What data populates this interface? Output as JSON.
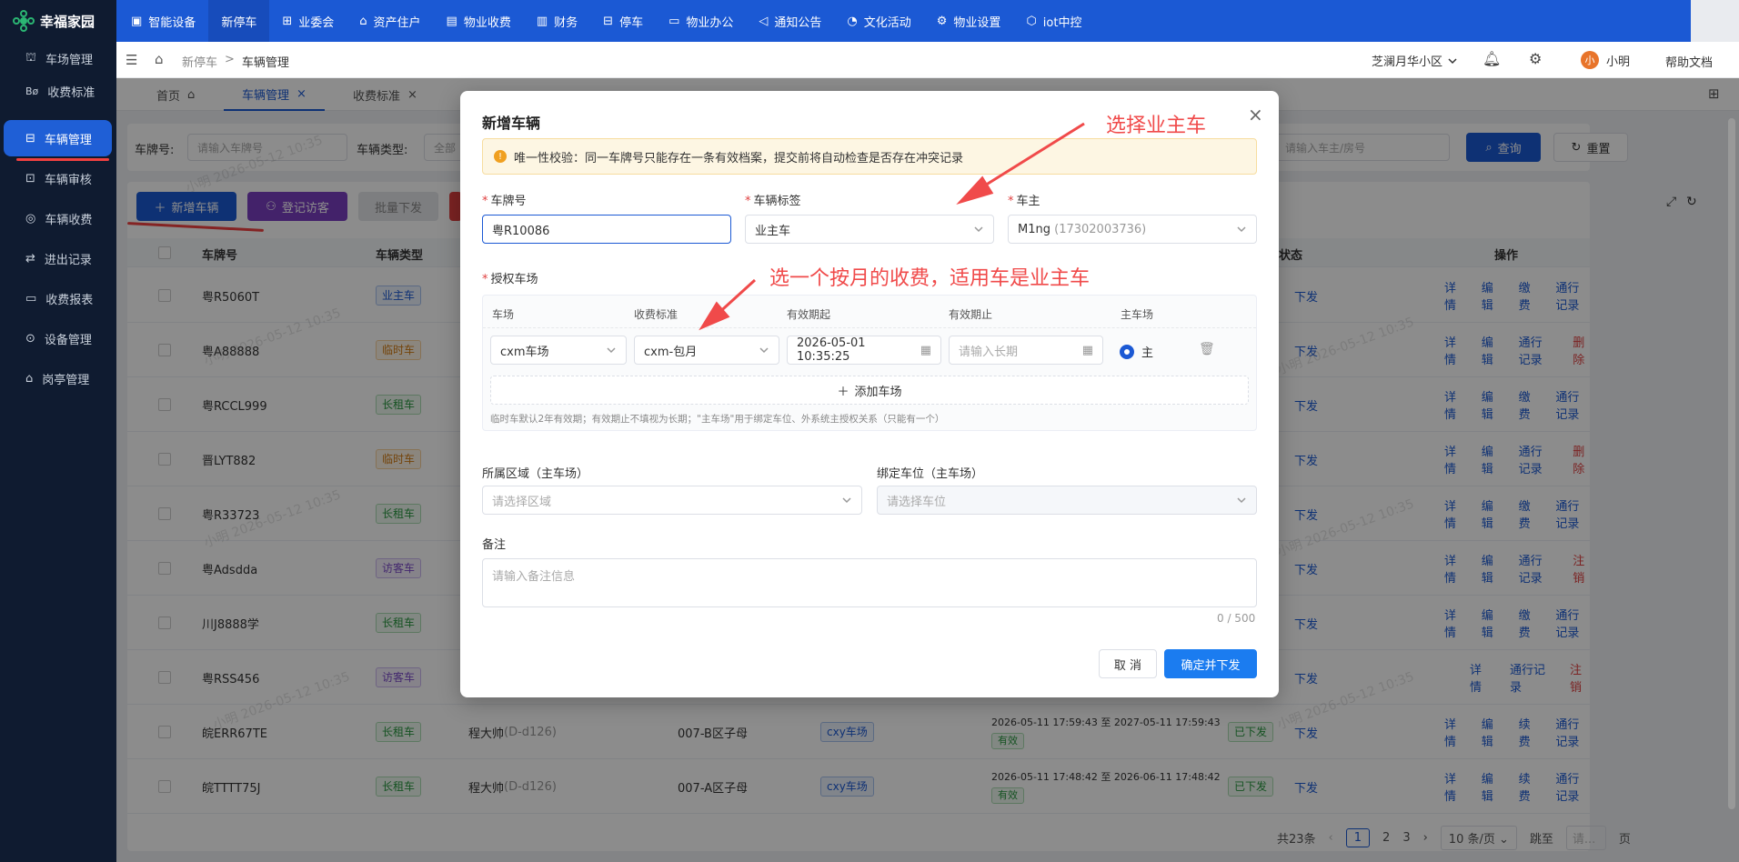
{
  "app": {
    "name": "幸福家园"
  },
  "sidebar": {
    "items": [
      {
        "label": "车场管理"
      },
      {
        "label": "收费标准"
      },
      {
        "label": "车辆管理"
      },
      {
        "label": "车辆审核"
      },
      {
        "label": "车辆收费"
      },
      {
        "label": "进出记录"
      },
      {
        "label": "收费报表"
      },
      {
        "label": "设备管理"
      },
      {
        "label": "岗亭管理"
      }
    ]
  },
  "topnav": {
    "items": [
      {
        "label": "智能设备"
      },
      {
        "label": "新停车"
      },
      {
        "label": "业委会"
      },
      {
        "label": "资产住户"
      },
      {
        "label": "物业收费"
      },
      {
        "label": "财务"
      },
      {
        "label": "停车"
      },
      {
        "label": "物业办公"
      },
      {
        "label": "通知公告"
      },
      {
        "label": "文化活动"
      },
      {
        "label": "物业设置"
      },
      {
        "label": "iot中控"
      }
    ]
  },
  "header": {
    "breadcrumb": [
      "新停车",
      "车辆管理"
    ],
    "separator": ">",
    "community": "芝澜月华小区",
    "avatar_char": "小",
    "user": "小明",
    "help": "帮助文档"
  },
  "tabs": [
    {
      "label": "首页"
    },
    {
      "label": "车辆管理"
    },
    {
      "label": "收费标准"
    }
  ],
  "filters": {
    "plate_label": "车牌号:",
    "plate_placeholder": "请输入车牌号",
    "type_label": "车辆类型:",
    "type_value": "全部",
    "owner_placeholder": "请输入车主/房号",
    "search_btn": "查询",
    "reset_btn": "重置"
  },
  "actions": {
    "add": "新增车辆",
    "visitor": "登记访客",
    "batch": "批量下发"
  },
  "table": {
    "headers": {
      "plate": "车牌号",
      "type": "车辆类型",
      "sync": "同步状态",
      "ops": "操作"
    },
    "rows": [
      {
        "plate": "粤R5060T",
        "type": "业主车",
        "color": "blue",
        "sync": "下发",
        "ops": [
          "详情",
          "编辑",
          "缴费",
          "通行记录"
        ]
      },
      {
        "plate": "粤A88888",
        "type": "临时车",
        "color": "orange",
        "sync": "下发",
        "ops": [
          "详情",
          "编辑",
          "通行记录",
          "删除"
        ]
      },
      {
        "plate": "粤RCCL999",
        "type": "长租车",
        "color": "green",
        "sync": "下发",
        "ops": [
          "详情",
          "编辑",
          "缴费",
          "通行记录"
        ]
      },
      {
        "plate": "晋LYT882",
        "type": "临时车",
        "color": "orange",
        "sync": "下发",
        "ops": [
          "详情",
          "编辑",
          "通行记录",
          "删除"
        ]
      },
      {
        "plate": "粤R33723",
        "type": "长租车",
        "color": "green",
        "sync": "下发",
        "ops": [
          "详情",
          "编辑",
          "缴费",
          "通行记录"
        ]
      },
      {
        "plate": "粤Adsdda",
        "type": "访客车",
        "color": "purple",
        "sync": "下发",
        "ops": [
          "详情",
          "编辑",
          "通行记录",
          "注销"
        ]
      },
      {
        "plate": "川J8888学",
        "type": "长租车",
        "color": "green",
        "sync": "下发",
        "ops": [
          "详情",
          "编辑",
          "缴费",
          "通行记录"
        ]
      },
      {
        "plate": "粤RSS456",
        "type": "访客车",
        "color": "purple",
        "sync": "下发",
        "ops": [
          "详情",
          "通行记录",
          "注销"
        ]
      },
      {
        "plate": "皖ERR67TE",
        "type": "长租车",
        "color": "green",
        "owner": "程大帅",
        "owner_room": "(D-d126)",
        "space": "007-B区子母",
        "lot": "cxy车场",
        "period": "2026-05-11 17:59:43 至 2027-05-11 17:59:43",
        "valid": "有效",
        "issued": "已下发",
        "sync": "下发",
        "ops": [
          "详情",
          "编辑",
          "续费",
          "通行记录"
        ]
      },
      {
        "plate": "皖TTTT75J",
        "type": "长租车",
        "color": "green",
        "owner": "程大帅",
        "owner_room": "(D-d126)",
        "space": "007-A区子母",
        "lot": "cxy车场",
        "period": "2026-05-11 17:48:42 至 2026-06-11 17:48:42",
        "valid": "有效",
        "issued": "已下发",
        "sync": "下发",
        "ops": [
          "详情",
          "编辑",
          "续费",
          "通行记录"
        ]
      }
    ]
  },
  "pagination": {
    "total": "共23条",
    "pages": [
      "1",
      "2",
      "3"
    ],
    "size": "10 条/页",
    "goto": "跳至",
    "goto_placeholder": "请...",
    "page_unit": "页"
  },
  "modal": {
    "title": "新增车辆",
    "notice": "唯一性校验：同一车牌号只能存在一条有效档案，提交前将自动检查是否存在冲突记录",
    "plate_label": "车牌号",
    "plate_value": "粤R10086",
    "tag_label": "车辆标签",
    "tag_value": "业主车",
    "owner_label": "车主",
    "owner_value": "M1ng",
    "owner_phone": "(17302003736)",
    "lots_label": "授权车场",
    "lot_headers": [
      "车场",
      "收费标准",
      "有效期起",
      "有效期止",
      "主车场"
    ],
    "lot_row": {
      "lot": "cxm车场",
      "fee": "cxm-包月",
      "start": "2026-05-01 10:35:25",
      "end_placeholder": "请输入长期",
      "main": "主"
    },
    "add_lot": "添加车场",
    "hint": "临时车默认2年有效期；有效期止不填视为长期；\"主车场\"用于绑定车位、外系统主授权关系（只能有一个）",
    "area_label": "所属区域（主车场）",
    "area_placeholder": "请选择区域",
    "space_label": "绑定车位（主车场）",
    "space_placeholder": "请选择车位",
    "remark_label": "备注",
    "remark_placeholder": "请输入备注信息",
    "remark_count": "0 / 500",
    "cancel": "取 消",
    "confirm": "确定并下发"
  },
  "annotations": {
    "a1": "选择业主车",
    "a2": "选一个按月的收费，适用车是业主车"
  },
  "watermark": "小明 2026-05-12 10:35",
  "colors": {
    "primary": "#1b59d4",
    "sidebar": "#0f1b30",
    "danger": "#e04040",
    "annotation": "#f04a4a"
  }
}
